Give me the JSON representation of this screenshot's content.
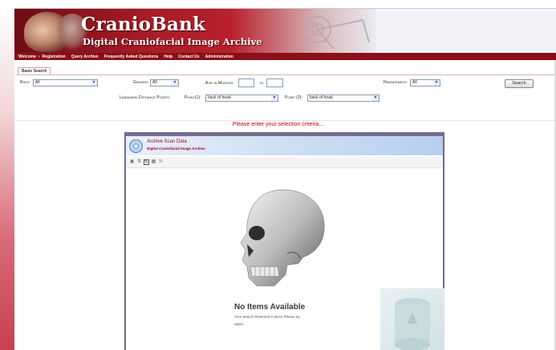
{
  "brand": {
    "title": "CranioBank",
    "subtitle": "Digital Craniofacial Image Archive"
  },
  "nav": [
    "Welcome",
    "Registration",
    "Query Archive",
    "Frequently Asked Questions",
    "Help",
    "Contact Us",
    "Administration"
  ],
  "nav_separator": "›",
  "search": {
    "tab_label": "Basic Search",
    "race_label": "Race:",
    "race_value": "All",
    "gender_label": "Gender:",
    "gender_value": "All",
    "age_label": "Age in Months:",
    "age_from": "",
    "age_to_label": "to",
    "age_to": "",
    "handedness_label": "Handedness:",
    "handedness_value": "All",
    "search_button": "Search",
    "landmark_label": "Landmark Distance Points:",
    "point1_label": "Point(1):",
    "point1_value": "back of head",
    "point2_label": "Point (2):",
    "point2_value": "back of head"
  },
  "prompt": "Please enter your selection criteria...",
  "archive": {
    "title": "Archive Scan Data",
    "subtitle": "Digital Craniofacial Image Archive",
    "empty_title": "No Items Available",
    "empty_message": "Your Search Returned 0 Items Please try again..."
  },
  "colors": {
    "brand_red": "#8a0f18",
    "prompt_red": "#b8000f",
    "panel_border": "#6c6c8c"
  },
  "icons": {
    "toolbar": [
      "export-icon",
      "sort-icon",
      "edit-icon",
      "grid-icon",
      "refresh-icon"
    ]
  }
}
